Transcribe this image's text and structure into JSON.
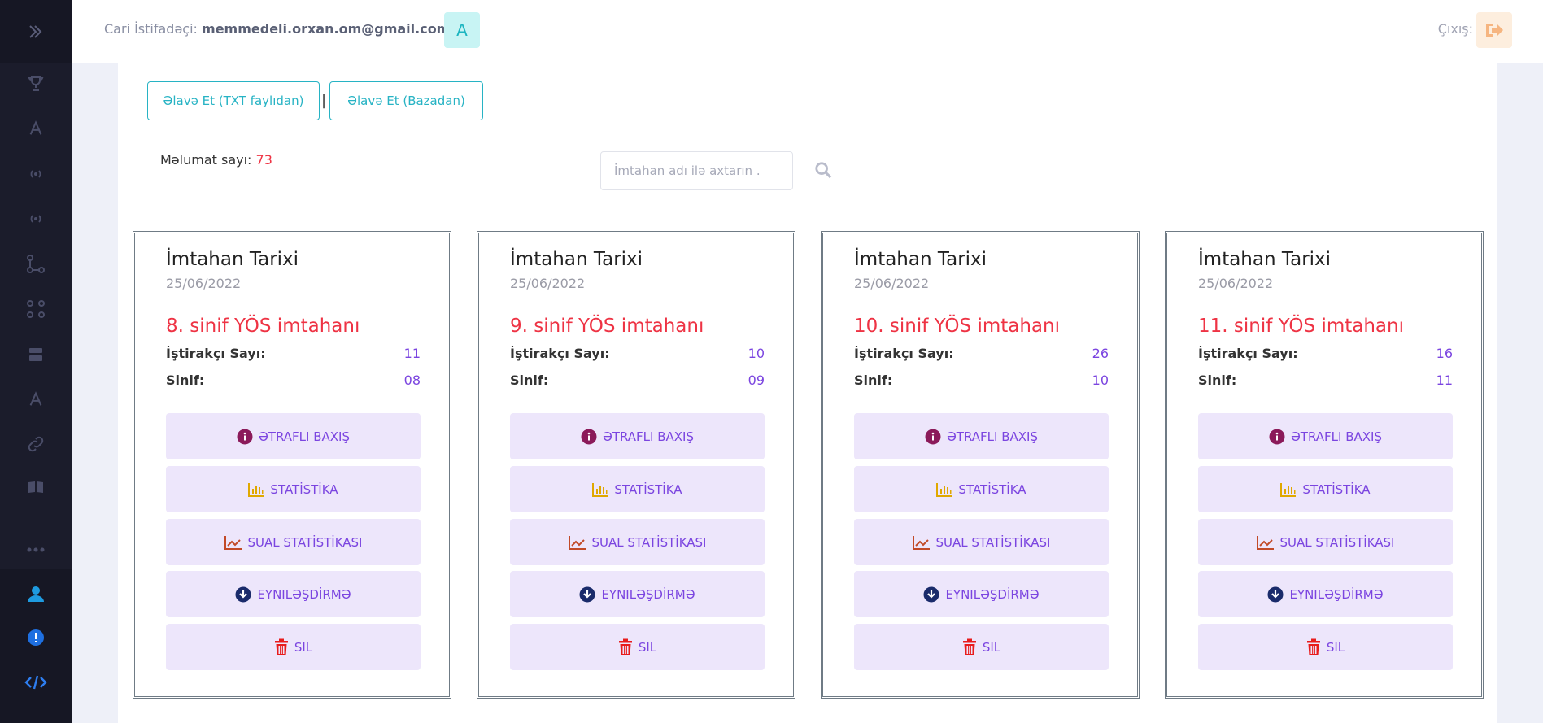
{
  "header": {
    "user_label": "Cari İstifadəçi:",
    "user_email": "memmedeli.orxan.om@gmail.com",
    "avatar_letter": "A",
    "logout_label": "Çıxış:"
  },
  "toolbar": {
    "add_txt_label": "Əlavə Et (TXT faylıdan)",
    "add_db_label": "Əlavə Et (Bazadan)",
    "separator": "|"
  },
  "info": {
    "count_label": "Məlumat sayı:",
    "count_value": "73"
  },
  "search": {
    "placeholder": "İmtahan adı ilə axtarın ."
  },
  "card_labels": {
    "date_label": "İmtahan Tarixi",
    "participants_label": "İştirakçı Sayı:",
    "class_label": "Sinif:",
    "details_button": "ƏTRAFLI BAXIŞ",
    "statistics_button": "STATİSTİKA",
    "question_stats_button": "SUAL STATİSTİKASI",
    "sync_button": "EYNILƏŞDİRMƏ",
    "delete_button": "SIL"
  },
  "cards": [
    {
      "date": "25/06/2022",
      "title": "8. sinif YÖS imtahanı",
      "participants": "11",
      "class": "08"
    },
    {
      "date": "25/06/2022",
      "title": "9. sinif YÖS imtahanı",
      "participants": "10",
      "class": "09"
    },
    {
      "date": "25/06/2022",
      "title": "10. sinif YÖS imtahanı",
      "participants": "26",
      "class": "10"
    },
    {
      "date": "25/06/2022",
      "title": "11. sinif YÖS imtahanı",
      "participants": "16",
      "class": "11"
    }
  ],
  "colors": {
    "accent_teal": "#27b3c4",
    "title_red": "#ee3344",
    "value_purple": "#7b45e0",
    "button_bg": "#ede6fb",
    "sidebar_bg": "#1b1c2b"
  }
}
